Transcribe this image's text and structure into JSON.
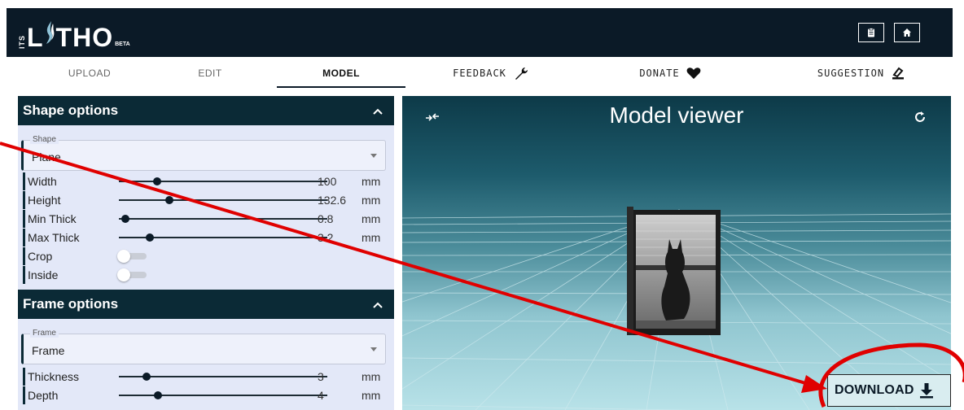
{
  "header": {
    "logo": {
      "its": "ITS",
      "l": "L",
      "tho": "THO",
      "beta": "BETA"
    },
    "buttons": [
      "clipboard-icon",
      "home-icon"
    ]
  },
  "tabs": [
    {
      "label": "UPLOAD",
      "active": false
    },
    {
      "label": "EDIT",
      "active": false
    },
    {
      "label": "MODEL",
      "active": true
    },
    {
      "label": "FEEDBACK",
      "icon": "wrench-icon"
    },
    {
      "label": "DONATE",
      "icon": "heart-icon"
    },
    {
      "label": "SUGGESTION",
      "icon": "pencil-icon"
    }
  ],
  "shape_options": {
    "title": "Shape options",
    "shape_field": {
      "label": "Shape",
      "value": "Plane"
    },
    "sliders": [
      {
        "label": "Width",
        "value": "100",
        "unit": "mm",
        "fraction": 0.18
      },
      {
        "label": "Height",
        "value": "132.6",
        "unit": "mm",
        "fraction": 0.24
      },
      {
        "label": "Min Thick",
        "value": "0.8",
        "unit": "mm",
        "fraction": 0.03
      },
      {
        "label": "Max Thick",
        "value": "3.2",
        "unit": "mm",
        "fraction": 0.14
      }
    ],
    "toggles": [
      {
        "label": "Crop",
        "on": false
      },
      {
        "label": "Inside",
        "on": false
      }
    ]
  },
  "frame_options": {
    "title": "Frame options",
    "frame_field": {
      "label": "Frame",
      "value": "Frame"
    },
    "sliders": [
      {
        "label": "Thickness",
        "value": "3",
        "unit": "mm",
        "fraction": 0.13
      },
      {
        "label": "Depth",
        "value": "4",
        "unit": "mm",
        "fraction": 0.18
      }
    ]
  },
  "viewer": {
    "title": "Model viewer",
    "download_label": "DOWNLOAD"
  },
  "colors": {
    "header_bg": "#0b1a27",
    "section_header": "#0b2a36",
    "panel_bg": "#e3e8f8",
    "annotation_red": "#e00000"
  }
}
